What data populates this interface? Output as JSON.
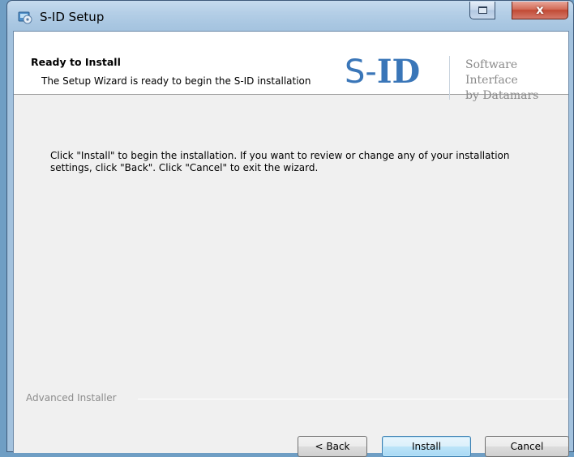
{
  "window": {
    "title": "S-ID Setup",
    "close_glyph": "x"
  },
  "header": {
    "title": "Ready to Install",
    "subtitle": "The Setup Wizard is ready to begin the S-ID installation"
  },
  "logo": {
    "prefix": "S-",
    "suffix": "ID",
    "tagline_line1": "Software Interface",
    "tagline_line2": "by Datamars"
  },
  "body": {
    "instructions": "Click \"Install\" to begin the installation.  If you want to review or change any of your installation settings, click \"Back\".  Click \"Cancel\" to exit the wizard."
  },
  "footer": {
    "branding": "Advanced Installer"
  },
  "buttons": {
    "back": "< Back",
    "install": "Install",
    "cancel": "Cancel"
  },
  "icons": {
    "app": "setup-disc-icon",
    "restore": "restore-window-icon",
    "close": "close-icon"
  },
  "colors": {
    "logo_blue": "#3a76b8",
    "close_red": "#c14a35",
    "default_button_border": "#3c7fb1"
  }
}
